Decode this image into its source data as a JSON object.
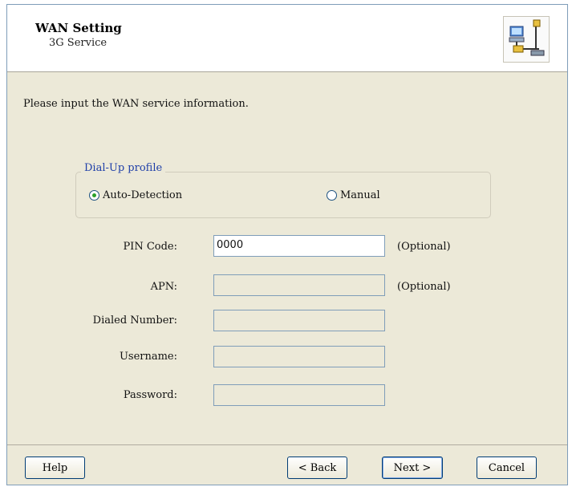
{
  "header": {
    "title": "WAN Setting",
    "subtitle": "3G Service",
    "icon": "network-wizard-icon"
  },
  "intro_text": "Please input the WAN service information.",
  "dialup": {
    "legend": "Dial-Up profile",
    "options": [
      {
        "label": "Auto-Detection",
        "selected": true
      },
      {
        "label": "Manual",
        "selected": false
      }
    ]
  },
  "form": {
    "pin": {
      "label": "PIN Code:",
      "value": "0000",
      "note": "(Optional)"
    },
    "apn": {
      "label": "APN:",
      "value": "",
      "note": "(Optional)"
    },
    "dialed": {
      "label": "Dialed Number:",
      "value": ""
    },
    "username": {
      "label": "Username:",
      "value": ""
    },
    "password": {
      "label": "Password:",
      "value": ""
    }
  },
  "buttons": {
    "help": "Help",
    "back": "< Back",
    "next": "Next >",
    "cancel": "Cancel"
  }
}
